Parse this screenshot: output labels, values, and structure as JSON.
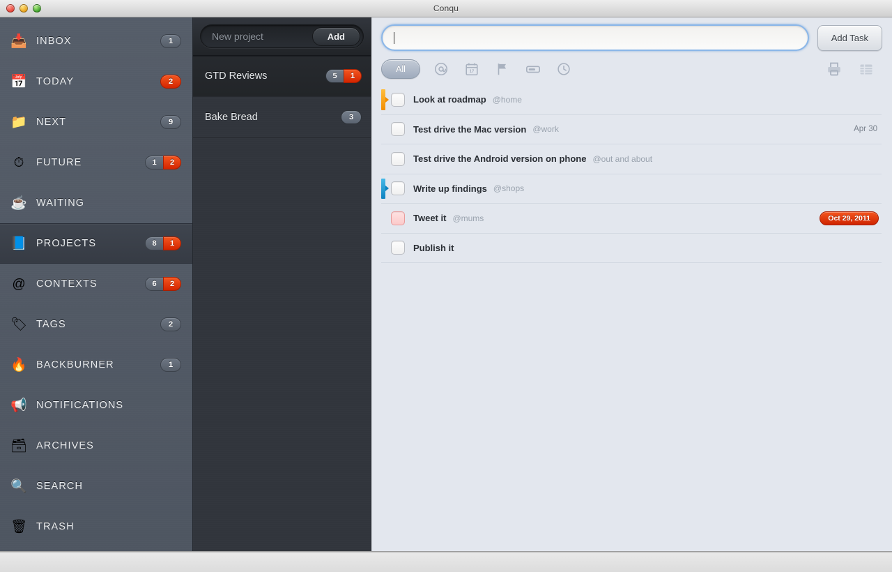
{
  "window": {
    "title": "Conqu",
    "traffic_lights": [
      "close-button",
      "minimize-button",
      "zoom-button"
    ]
  },
  "sidebar": {
    "items": [
      {
        "label": "INBOX",
        "icon": "inbox-tray-icon",
        "glyph": "📥",
        "badges": [
          {
            "value": "1",
            "style": "gray"
          }
        ],
        "selected": false
      },
      {
        "label": "TODAY",
        "icon": "calendar-icon",
        "glyph": "📅",
        "badges": [
          {
            "value": "2",
            "style": "red"
          }
        ],
        "selected": false
      },
      {
        "label": "NEXT",
        "icon": "folder-icon",
        "glyph": "📁",
        "badges": [
          {
            "value": "9",
            "style": "gray"
          }
        ],
        "selected": false
      },
      {
        "label": "FUTURE",
        "icon": "clock-icon",
        "glyph": "⏱",
        "badges": [
          {
            "value": "1",
            "style": "gray"
          },
          {
            "value": "2",
            "style": "red"
          }
        ],
        "selected": false
      },
      {
        "label": "WAITING",
        "icon": "coffee-cup-icon",
        "glyph": "☕",
        "badges": [],
        "selected": false
      },
      {
        "label": "PROJECTS",
        "icon": "project-book-icon",
        "glyph": "📘",
        "badges": [
          {
            "value": "8",
            "style": "gray"
          },
          {
            "value": "1",
            "style": "red"
          }
        ],
        "selected": true
      },
      {
        "label": "CONTEXTS",
        "icon": "at-sign-icon",
        "glyph": "@",
        "badges": [
          {
            "value": "6",
            "style": "gray"
          },
          {
            "value": "2",
            "style": "red"
          }
        ],
        "selected": false
      },
      {
        "label": "TAGS",
        "icon": "tags-icon",
        "glyph": "🏷",
        "badges": [
          {
            "value": "2",
            "style": "gray"
          }
        ],
        "selected": false
      },
      {
        "label": "BACKBURNER",
        "icon": "flame-icon",
        "glyph": "🔥",
        "badges": [
          {
            "value": "1",
            "style": "gray"
          }
        ],
        "selected": false
      },
      {
        "label": "NOTIFICATIONS",
        "icon": "megaphone-icon",
        "glyph": "📢",
        "badges": [],
        "selected": false
      },
      {
        "label": "ARCHIVES",
        "icon": "archive-box-icon",
        "glyph": "🗃",
        "badges": [],
        "selected": false
      },
      {
        "label": "SEARCH",
        "icon": "magnifier-icon",
        "glyph": "🔍",
        "badges": [],
        "selected": false
      },
      {
        "label": "TRASH",
        "icon": "trash-can-icon",
        "glyph": "🗑",
        "badges": [],
        "selected": false
      }
    ]
  },
  "projects": {
    "new_project_placeholder": "New project",
    "add_button_label": "Add",
    "items": [
      {
        "name": "GTD Reviews",
        "badges": [
          {
            "value": "5",
            "style": "gray"
          },
          {
            "value": "1",
            "style": "red"
          }
        ],
        "selected": true
      },
      {
        "name": "Bake Bread",
        "badges": [
          {
            "value": "3",
            "style": "gray"
          }
        ],
        "selected": false
      }
    ]
  },
  "main": {
    "task_input": {
      "value": "",
      "placeholder": ""
    },
    "add_task_label": "Add Task",
    "filters": [
      {
        "label": "All",
        "icon": "all-filter-pill",
        "active": true
      },
      {
        "label": "",
        "icon": "at-sign-icon",
        "active": false
      },
      {
        "label": "",
        "icon": "calendar-icon",
        "active": false
      },
      {
        "label": "",
        "icon": "flag-icon",
        "active": false
      },
      {
        "label": "",
        "icon": "tag-icon",
        "active": false
      },
      {
        "label": "",
        "icon": "clock-icon",
        "active": false
      }
    ],
    "tools": [
      {
        "icon": "printer-icon"
      },
      {
        "icon": "list-view-icon"
      }
    ],
    "tasks": [
      {
        "title": "Look at roadmap",
        "context": "@home",
        "date": "",
        "marker": "orange",
        "overdue": false
      },
      {
        "title": "Test drive the Mac version",
        "context": "@work",
        "date": "Apr 30",
        "marker": "",
        "overdue": false
      },
      {
        "title": "Test drive the Android version on phone",
        "context": "@out and about",
        "date": "",
        "marker": "",
        "overdue": false
      },
      {
        "title": "Write up findings",
        "context": "@shops",
        "date": "",
        "marker": "blue",
        "overdue": false
      },
      {
        "title": "Tweet it",
        "context": "@mums",
        "date": "Oct 29, 2011",
        "marker": "",
        "overdue": true
      },
      {
        "title": "Publish it",
        "context": "",
        "date": "",
        "marker": "",
        "overdue": false
      }
    ]
  },
  "colors": {
    "sidebar_bg": "#525a66",
    "projects_bg": "#31353c",
    "main_bg": "#e3e7ee",
    "badge_red": "#d32500",
    "marker_orange": "#f28d00",
    "marker_blue": "#0d82c0",
    "input_focus_ring": "#8ab6e8"
  }
}
